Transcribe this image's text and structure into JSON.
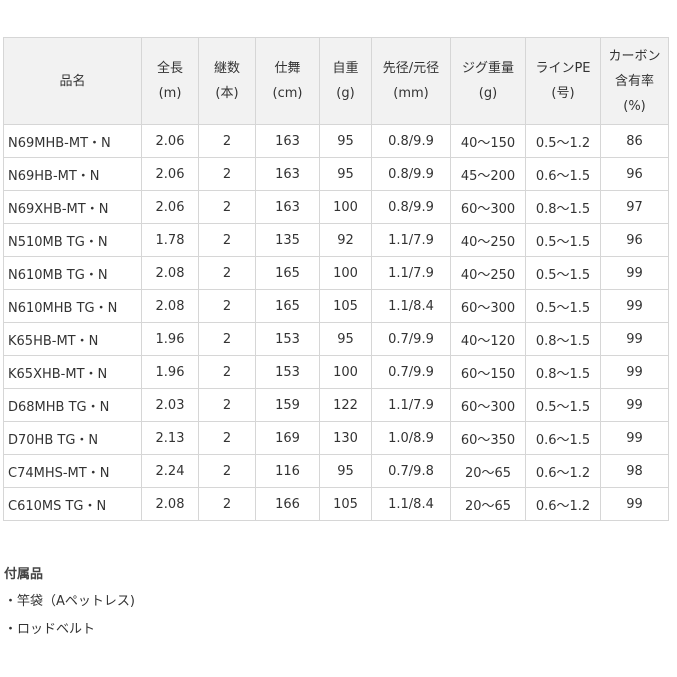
{
  "table": {
    "headers": [
      [
        "品名"
      ],
      [
        "全長",
        "(m)"
      ],
      [
        "継数",
        "(本)"
      ],
      [
        "仕舞",
        "(cm)"
      ],
      [
        "自重",
        "(g)"
      ],
      [
        "先径/元径",
        "(mm)"
      ],
      [
        "ジグ重量",
        "(g)"
      ],
      [
        "ラインPE",
        "(号)"
      ],
      [
        "カーボン",
        "含有率",
        "(%)"
      ]
    ],
    "rows": [
      [
        "N69MHB-MT・N",
        "2.06",
        "2",
        "163",
        "95",
        "0.8/9.9",
        "40〜150",
        "0.5〜1.2",
        "86"
      ],
      [
        "N69HB-MT・N",
        "2.06",
        "2",
        "163",
        "95",
        "0.8/9.9",
        "45〜200",
        "0.6〜1.5",
        "96"
      ],
      [
        "N69XHB-MT・N",
        "2.06",
        "2",
        "163",
        "100",
        "0.8/9.9",
        "60〜300",
        "0.8〜1.5",
        "97"
      ],
      [
        "N510MB TG・N",
        "1.78",
        "2",
        "135",
        "92",
        "1.1/7.9",
        "40〜250",
        "0.5〜1.5",
        "96"
      ],
      [
        "N610MB TG・N",
        "2.08",
        "2",
        "165",
        "100",
        "1.1/7.9",
        "40〜250",
        "0.5〜1.5",
        "99"
      ],
      [
        "N610MHB TG・N",
        "2.08",
        "2",
        "165",
        "105",
        "1.1/8.4",
        "60〜300",
        "0.5〜1.5",
        "99"
      ],
      [
        "K65HB-MT・N",
        "1.96",
        "2",
        "153",
        "95",
        "0.7/9.9",
        "40〜120",
        "0.8〜1.5",
        "99"
      ],
      [
        "K65XHB-MT・N",
        "1.96",
        "2",
        "153",
        "100",
        "0.7/9.9",
        "60〜150",
        "0.8〜1.5",
        "99"
      ],
      [
        "D68MHB TG・N",
        "2.03",
        "2",
        "159",
        "122",
        "1.1/7.9",
        "60〜300",
        "0.5〜1.5",
        "99"
      ],
      [
        "D70HB TG・N",
        "2.13",
        "2",
        "169",
        "130",
        "1.0/8.9",
        "60〜350",
        "0.6〜1.5",
        "99"
      ],
      [
        "C74MHS-MT・N",
        "2.24",
        "2",
        "116",
        "95",
        "0.7/9.8",
        "20〜65",
        "0.6〜1.2",
        "98"
      ],
      [
        "C610MS TG・N",
        "2.08",
        "2",
        "166",
        "105",
        "1.1/8.4",
        "20〜65",
        "0.6〜1.2",
        "99"
      ]
    ]
  },
  "accessories": {
    "title": "付属品",
    "items": [
      "・竿袋（Aペットレス)",
      "・ロッドベルト"
    ]
  }
}
